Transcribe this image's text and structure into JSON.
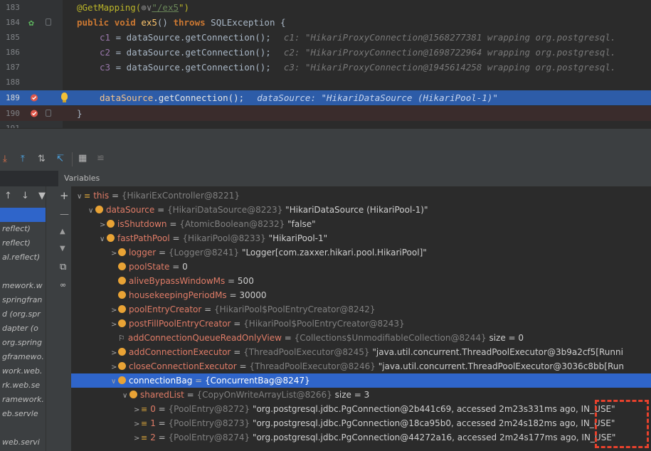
{
  "editor": {
    "lines": [
      {
        "num": "183"
      },
      {
        "num": "184"
      },
      {
        "num": "185"
      },
      {
        "num": "186"
      },
      {
        "num": "187"
      },
      {
        "num": "188"
      },
      {
        "num": "189"
      },
      {
        "num": "190"
      },
      {
        "num": "191"
      }
    ],
    "l183": {
      "annot": "@GetMapping(",
      "icon": "⊕∨",
      "q1": "\"",
      "path": "/ex5",
      "q2": "\")"
    },
    "l184": {
      "kw1": "public",
      "kw2": "void",
      "fn": "ex5",
      "rest": "() ",
      "kw3": "throws",
      "exc": " SQLException {"
    },
    "l185": {
      "var": "c1",
      "code": " = dataSource.getConnection();",
      "hint": "c1: \"HikariProxyConnection@1568277381 wrapping org.postgresql."
    },
    "l186": {
      "var": "c2",
      "code": " = dataSource.getConnection();",
      "hint": "c2: \"HikariProxyConnection@1698722964 wrapping org.postgresql."
    },
    "l187": {
      "var": "c3",
      "code": " = dataSource.getConnection();",
      "hint": "c3: \"HikariProxyConnection@1945614258 wrapping org.postgresql."
    },
    "l189": {
      "var": "dataSource",
      "code": ".getConnection();",
      "hint": "dataSource: \"HikariDataSource (HikariPool-1)\""
    },
    "l190": {
      "code": "}"
    }
  },
  "debugger": {
    "panel_title": "Variables",
    "frames": [
      "",
      "reflect)",
      "reflect)",
      "al.reflect)",
      "",
      "mework.w",
      "springfran",
      "d (org.spr",
      "dapter (o",
      "org.spring",
      "gframewo.",
      "work.web.",
      "rk.web.se",
      "ramework.",
      "eb.servle",
      "",
      "web.servi"
    ],
    "variables": [
      {
        "indent": 0,
        "arrow": "∨",
        "icon": "list",
        "name": "this",
        "type": "{HikariExController@8221}",
        "value": ""
      },
      {
        "indent": 1,
        "arrow": "∨",
        "icon": "field",
        "name": "dataSource",
        "type": "{HikariDataSource@8223}",
        "value": "\"HikariDataSource (HikariPool-1)\""
      },
      {
        "indent": 2,
        "arrow": ">",
        "icon": "field",
        "name": "isShutdown",
        "type": "{AtomicBoolean@8232}",
        "value": "\"false\""
      },
      {
        "indent": 2,
        "arrow": "∨",
        "icon": "field",
        "name": "fastPathPool",
        "type": "{HikariPool@8233}",
        "value": "\"HikariPool-1\""
      },
      {
        "indent": 3,
        "arrow": ">",
        "icon": "field",
        "name": "logger",
        "type": "{Logger@8241}",
        "value": "\"Logger[com.zaxxer.hikari.pool.HikariPool]\""
      },
      {
        "indent": 3,
        "arrow": "",
        "icon": "field",
        "name": "poolState",
        "type": "",
        "value": "0"
      },
      {
        "indent": 3,
        "arrow": "",
        "icon": "field",
        "name": "aliveBypassWindowMs",
        "type": "",
        "value": "500"
      },
      {
        "indent": 3,
        "arrow": "",
        "icon": "field",
        "name": "housekeepingPeriodMs",
        "type": "",
        "value": "30000"
      },
      {
        "indent": 3,
        "arrow": ">",
        "icon": "field",
        "name": "poolEntryCreator",
        "type": "{HikariPool$PoolEntryCreator@8242}",
        "value": ""
      },
      {
        "indent": 3,
        "arrow": ">",
        "icon": "field",
        "name": "postFillPoolEntryCreator",
        "type": "{HikariPool$PoolEntryCreator@8243}",
        "value": ""
      },
      {
        "indent": 3,
        "arrow": "",
        "icon": "flag",
        "name": "addConnectionQueueReadOnlyView",
        "type": "{Collections$UnmodifiableCollection@8244}",
        "value": "size = 0"
      },
      {
        "indent": 3,
        "arrow": ">",
        "icon": "field",
        "name": "addConnectionExecutor",
        "type": "{ThreadPoolExecutor@8245}",
        "value": "\"java.util.concurrent.ThreadPoolExecutor@3b9a2cf5[Runni"
      },
      {
        "indent": 3,
        "arrow": ">",
        "icon": "field",
        "name": "closeConnectionExecutor",
        "type": "{ThreadPoolExecutor@8246}",
        "value": "\"java.util.concurrent.ThreadPoolExecutor@3036c8bb[Run"
      },
      {
        "indent": 3,
        "arrow": "∨",
        "icon": "field",
        "name": "connectionBag",
        "type": "{ConcurrentBag@8247}",
        "value": "",
        "selected": true
      },
      {
        "indent": 4,
        "arrow": "∨",
        "icon": "field",
        "name": "sharedList",
        "type": "{CopyOnWriteArrayList@8266}",
        "value": "size = 3"
      },
      {
        "indent": 5,
        "arrow": ">",
        "icon": "list",
        "name": "0",
        "type": "{PoolEntry@8272}",
        "value": "\"org.postgresql.jdbc.PgConnection@2b441c69, accessed 2m23s331ms ago, IN_USE\""
      },
      {
        "indent": 5,
        "arrow": ">",
        "icon": "list",
        "name": "1",
        "type": "{PoolEntry@8273}",
        "value": "\"org.postgresql.jdbc.PgConnection@18ca95b0, accessed 2m24s182ms ago, IN_USE\""
      },
      {
        "indent": 5,
        "arrow": ">",
        "icon": "list",
        "name": "2",
        "type": "{PoolEntry@8274}",
        "value": "\"org.postgresql.jdbc.PgConnection@44272a16, accessed 2m24s177ms ago, IN_USE\""
      }
    ]
  },
  "colors": {
    "accent": "#2f65ca",
    "field_name": "#e07c67",
    "highlight_box": "#e8412c"
  }
}
